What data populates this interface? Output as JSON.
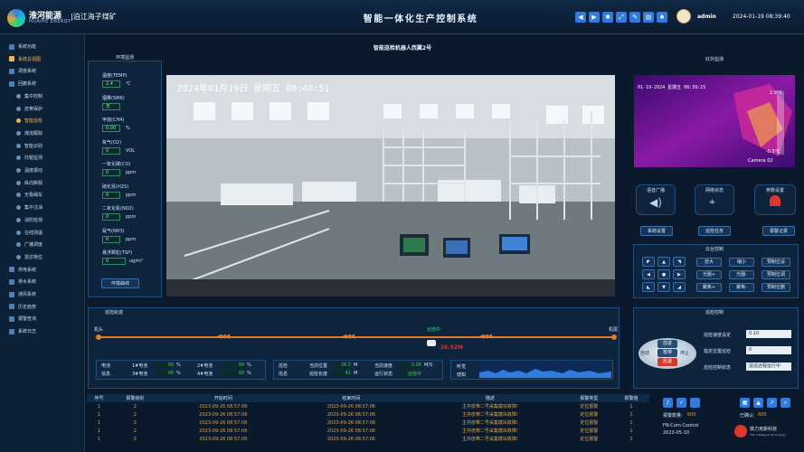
{
  "header": {
    "brand": "淮河能源",
    "brand_en": "HUAIHE ENERGY",
    "mine": "|泊江海子煤矿",
    "title": "智能一体化生产控制系统",
    "user": "admin",
    "datetime": "2024-01-19 08:39:40",
    "icons": [
      "arrow-left-icon",
      "arrow-right-icon",
      "settings-icon",
      "expand-icon",
      "edit-icon",
      "print-icon",
      "shirt-icon"
    ]
  },
  "nav": {
    "items": [
      {
        "label": "系统功能",
        "level": 0,
        "active": false
      },
      {
        "label": "系统总视图",
        "level": 0,
        "active": true
      },
      {
        "label": "调度系统",
        "level": 0,
        "active": false
      },
      {
        "label": "回撤系统",
        "level": 0,
        "active": false
      },
      {
        "label": "集中控制",
        "level": 1,
        "active": false
      },
      {
        "label": "皮带保护",
        "level": 1,
        "active": false
      },
      {
        "label": "智能巡检",
        "level": 1,
        "active": true
      },
      {
        "label": "煤流跟踪",
        "level": 1,
        "active": false
      },
      {
        "label": "智能识别",
        "level": 1,
        "active": false
      },
      {
        "label": "托辊监测",
        "level": 1,
        "active": false
      },
      {
        "label": "温度振动",
        "level": 1,
        "active": false
      },
      {
        "label": "纵向撕裂",
        "level": 1,
        "active": false
      },
      {
        "label": "无极绳车",
        "level": 1,
        "active": false
      },
      {
        "label": "集中注油",
        "level": 1,
        "active": false
      },
      {
        "label": "消防检测",
        "level": 1,
        "active": false
      },
      {
        "label": "在线测温",
        "level": 1,
        "active": false
      },
      {
        "label": "广播调度",
        "level": 1,
        "active": false
      },
      {
        "label": "雷达物位",
        "level": 1,
        "active": false
      },
      {
        "label": "供电系统",
        "level": 0,
        "active": false
      },
      {
        "label": "排水系统",
        "level": 0,
        "active": false
      },
      {
        "label": "通风系统",
        "level": 0,
        "active": false
      },
      {
        "label": "历史趋势",
        "level": 0,
        "active": false
      },
      {
        "label": "报警查询",
        "level": 0,
        "active": false
      },
      {
        "label": "系统日志",
        "level": 0,
        "active": false
      }
    ]
  },
  "robot_title": "智能巡检机器人西翼2号",
  "env": {
    "title": "环境监测",
    "button": "环境曲线",
    "sensors": [
      {
        "label": "温度(TEMP)",
        "value": "2.4",
        "unit": "℃"
      },
      {
        "label": "烟雾(SMK)",
        "value": "无",
        "unit": ""
      },
      {
        "label": "甲烷(CH4)",
        "value": "0.00",
        "unit": "%"
      },
      {
        "label": "氧气(O2)",
        "value": "0",
        "unit": "VOL"
      },
      {
        "label": "一氧化碳(CO)",
        "value": "0",
        "unit": "ppm"
      },
      {
        "label": "硫化氢(H2S)",
        "value": "0",
        "unit": "ppm"
      },
      {
        "label": "二氧化氮(NO2)",
        "value": "0",
        "unit": "ppm"
      },
      {
        "label": "氨气(NH3)",
        "value": "0",
        "unit": "ppm"
      },
      {
        "label": "悬浮颗粒(TSP)",
        "value": "0",
        "unit": "ug/m³"
      }
    ]
  },
  "camera": {
    "overlay_time": "2024年01月19日  星期五  08:40:51"
  },
  "infrared": {
    "title": "红外监测",
    "stamp": "01-19-2024 星期五 08:39:15",
    "max": "2.9°C",
    "min": "-0.5°C",
    "label": "Camera 02"
  },
  "status_icons": [
    {
      "label": "语音广播",
      "icon": "speaker-icon"
    },
    {
      "label": "网络状态",
      "icon": "satellite-icon"
    },
    {
      "label": "参数设置",
      "icon": "alarm-light-icon"
    }
  ],
  "actions": [
    "系统设置",
    "巡检任务",
    "报警记录"
  ],
  "ptz": {
    "title": "云台控制",
    "buttons": [
      "放大",
      "缩小",
      "预制位设",
      "光圈+",
      "光圈-",
      "预制位调",
      "聚焦+",
      "聚焦-",
      "预制位删"
    ]
  },
  "track": {
    "title": "巡检轨迹",
    "left": "机头",
    "right": "机尾",
    "status": "巡检中",
    "distance": "26.52M"
  },
  "battery": {
    "rows": [
      {
        "label": "电池",
        "b1": "1#电池",
        "v1": "99",
        "u1": "%",
        "b2": "2#电池",
        "v2": "99",
        "u2": "%"
      },
      {
        "label": "信息",
        "b1": "3#电池",
        "v1": "99",
        "u1": "%",
        "b2": "4#电池",
        "v2": "99",
        "u2": "%"
      }
    ]
  },
  "patrol": {
    "rows": [
      {
        "label": "巡检",
        "k1": "当前位置",
        "v1": "26.5",
        "u1": "M",
        "k2": "当前速度",
        "v2": "0.08",
        "u2": "M/S"
      },
      {
        "label": "信息",
        "k1": "巡检长度",
        "v1": "42",
        "u1": "M",
        "k2": "运行状态",
        "v2": "巡检中",
        "u2": ""
      }
    ]
  },
  "audio": {
    "l1": "听觉",
    "l2": "感知"
  },
  "control": {
    "title": "巡检控制",
    "center": [
      "前进",
      "暂停",
      "后退"
    ],
    "left": "自动",
    "right": "停止",
    "rows": [
      {
        "label": "巡检速度设定",
        "value": "0.10"
      },
      {
        "label": "指定位置巡检",
        "value": "0"
      },
      {
        "label": "巡检控制状态",
        "value": "遥遥远程运行中"
      }
    ]
  },
  "alarms": {
    "columns": [
      "序号",
      "报警级别",
      "开始时间",
      "结束时间",
      "描述",
      "报警类型",
      "报警值"
    ],
    "rows": [
      [
        "1",
        "2",
        "2023-09-26 08:57:06",
        "2023-09-26 08:57:06",
        "主井皮带二号采集模块故障!",
        "定位报警",
        "1"
      ],
      [
        "1",
        "2",
        "2023-09-26 08:57:06",
        "2023-09-26 08:57:06",
        "主井皮带二号采集模块故障!",
        "定位报警",
        "1"
      ],
      [
        "1",
        "2",
        "2023-09-26 08:57:06",
        "2023-09-26 08:57:06",
        "主井皮带二号采集模块故障!",
        "定位报警",
        "1"
      ],
      [
        "1",
        "2",
        "2023-09-26 08:57:06",
        "2023-09-26 08:57:06",
        "主井皮带二号采集模块故障!",
        "定位报警",
        "1"
      ],
      [
        "1",
        "2",
        "2023-09-26 08:57:06",
        "2023-09-26 08:57:06",
        "主井皮带二号采集模块故障!",
        "定位报警",
        "1"
      ]
    ]
  },
  "footer": {
    "alarm_count_label": "报警数量:",
    "alarm_count": "600",
    "confirmed_label": "已确认:",
    "confirmed": "600",
    "version": "FN-Com Control",
    "version_date": "2023-05-10",
    "company": "菲力克斯科技",
    "company_en": "FNX Intelligent Technology"
  }
}
